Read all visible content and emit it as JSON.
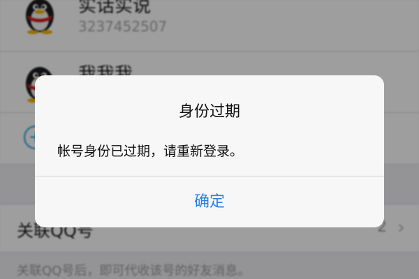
{
  "accounts": [
    {
      "name": "实话实说",
      "number": "3237452507",
      "avatar_icon": "qq-penguin-icon"
    },
    {
      "name": "我我我",
      "avatar_icon": "qq-penguin-icon"
    }
  ],
  "add_account": {
    "icon": "plus-circle-icon",
    "symbol": "+"
  },
  "link_section": {
    "label": "关联QQ号",
    "count": "2",
    "chevron": "›",
    "hint": "关联QQ号后，即可代收该号的好友消息。"
  },
  "alert": {
    "title": "身份过期",
    "message": "帐号身份已过期，请重新登录。",
    "confirm_label": "确定"
  },
  "colors": {
    "accent": "#2f7ee0",
    "add_icon": "#1aa0e8",
    "background": "#efeff4"
  }
}
